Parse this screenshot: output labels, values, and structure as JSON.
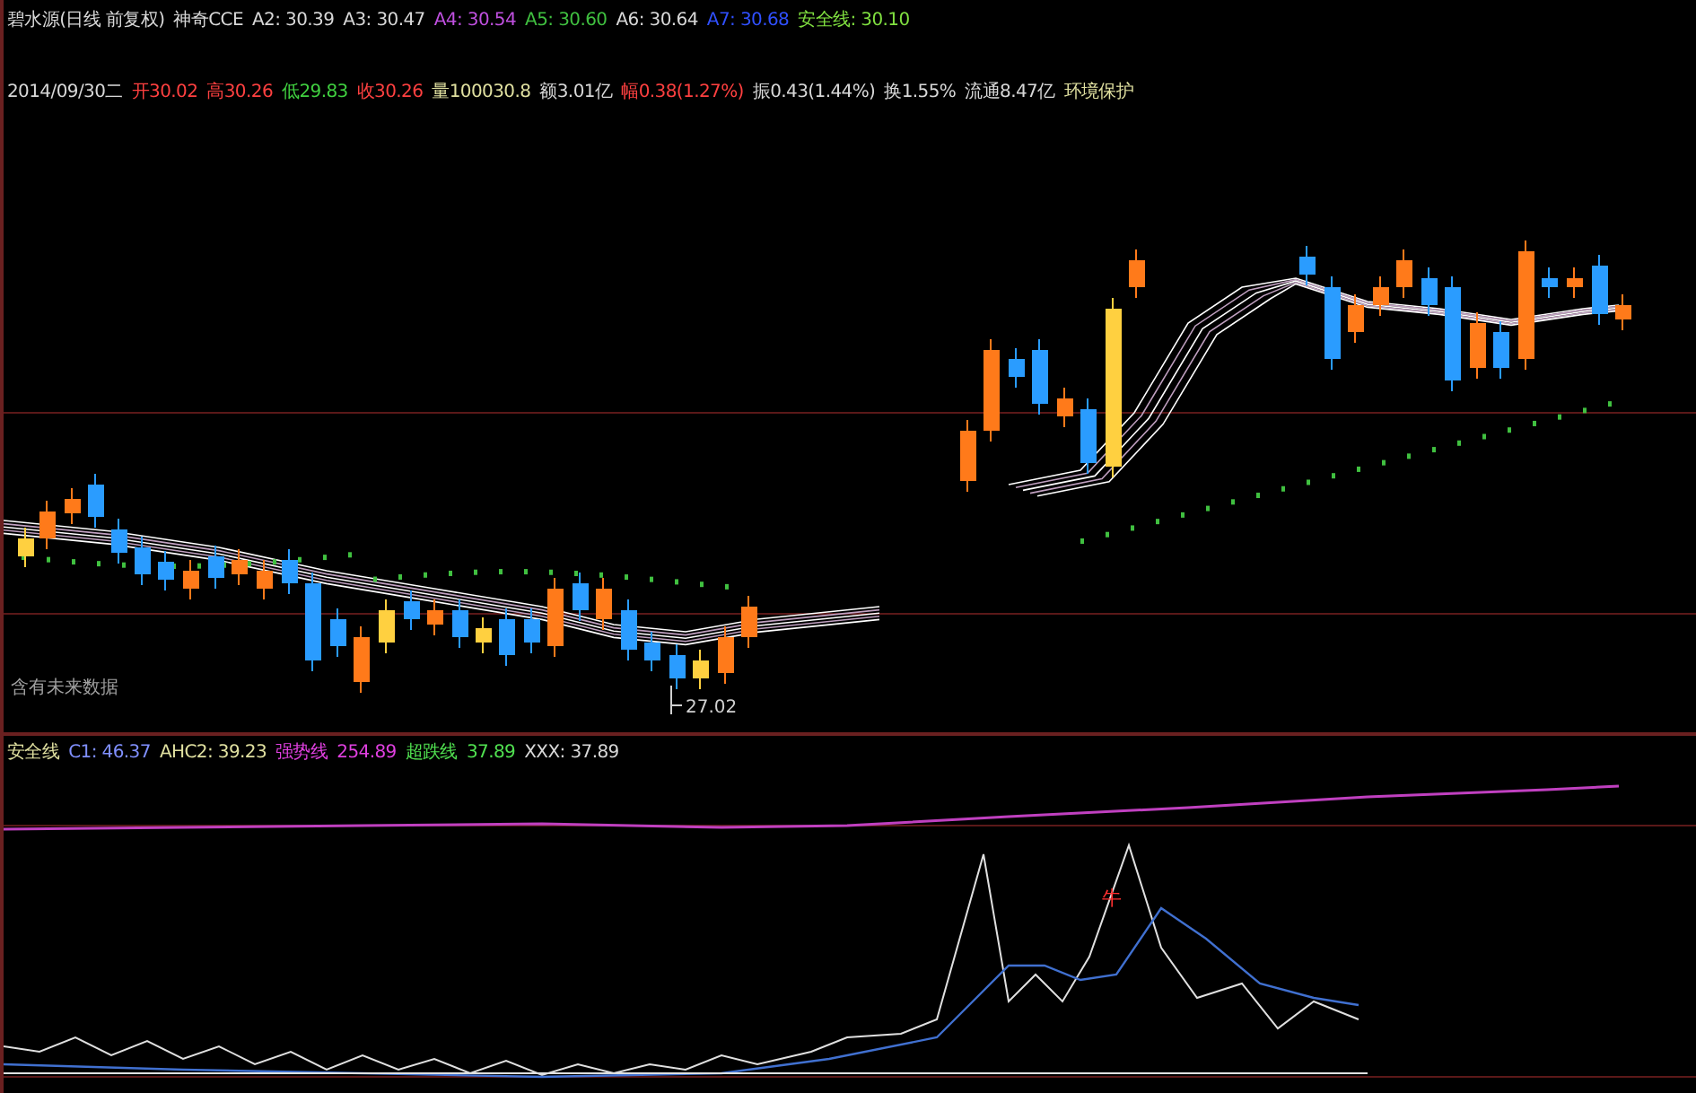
{
  "title_bar": {
    "items": [
      {
        "text": "碧水源(日线 前复权)",
        "color": "#d8d8d8"
      },
      {
        "text": "神奇CCE",
        "color": "#d8d8d8"
      },
      {
        "text": "A2: 30.39",
        "color": "#d8d8d8"
      },
      {
        "text": "A3: 30.47",
        "color": "#d8d8d8"
      },
      {
        "text": "A4: 30.54",
        "color": "#c050e0"
      },
      {
        "text": "A5: 30.60",
        "color": "#40c040"
      },
      {
        "text": "A6: 30.64",
        "color": "#d8d8d8"
      },
      {
        "text": "A7: 30.68",
        "color": "#3050ff"
      },
      {
        "text": "安全线: 30.10",
        "color": "#80e040"
      }
    ]
  },
  "quote_line": {
    "items": [
      {
        "text": "2014/09/30二",
        "color": "#d8d8d8"
      },
      {
        "text": "开30.02",
        "color": "#ff4040"
      },
      {
        "text": "高30.26",
        "color": "#ff4040"
      },
      {
        "text": "低29.83",
        "color": "#40d040"
      },
      {
        "text": "收30.26",
        "color": "#ff4040"
      },
      {
        "text": "量100030.8",
        "color": "#e0e0a0"
      },
      {
        "text": "额3.01亿",
        "color": "#d8d8d8"
      },
      {
        "text": "幅0.38(1.27%)",
        "color": "#ff4040"
      },
      {
        "text": "振0.43(1.44%)",
        "color": "#d8d8d8"
      },
      {
        "text": "换1.55%",
        "color": "#d8d8d8"
      },
      {
        "text": "流通8.47亿",
        "color": "#d8d8d8"
      },
      {
        "text": "环境保护",
        "color": "#e0e0a0"
      }
    ]
  },
  "main_chart": {
    "note": "含有未来数据",
    "low_label": "27.02"
  },
  "indicator": {
    "items": [
      {
        "text": "安全线",
        "color": "#e0e0a0"
      },
      {
        "text": "C1: 46.37",
        "color": "#8090ff"
      },
      {
        "text": "AHC2: 39.23",
        "color": "#e0e0a0"
      },
      {
        "text": "强势线",
        "color": "#e040e0"
      },
      {
        "text": "254.89",
        "color": "#e040e0"
      },
      {
        "text": "超跌线",
        "color": "#50e050"
      },
      {
        "text": "37.89",
        "color": "#50e050"
      },
      {
        "text": "XXX: 37.89",
        "color": "#d8d8d8"
      }
    ],
    "signal_label": "牛"
  }
}
